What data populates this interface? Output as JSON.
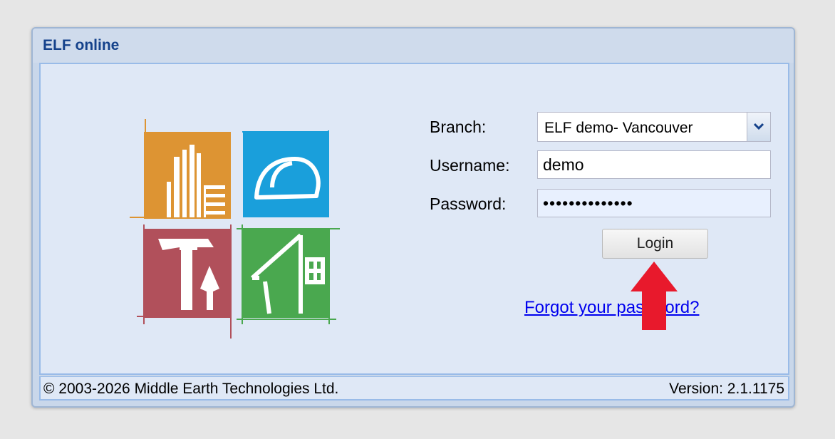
{
  "window": {
    "title": "ELF online"
  },
  "form": {
    "branch_label": "Branch:",
    "branch_value": "ELF demo- Vancouver",
    "username_label": "Username:",
    "username_value": "demo",
    "password_label": "Password:",
    "password_value": "••••••••••••••",
    "login_label": "Login",
    "forgot_link": "Forgot your password?"
  },
  "footer": {
    "copyright": "© 2003-2026 Middle Earth Technologies Ltd.",
    "version": "Version:  2.1.1175"
  },
  "icons": {
    "branch_dropdown": "chevron-down-icon",
    "annotation": "red-up-arrow-icon",
    "logo": "elf-logo"
  },
  "colors": {
    "title": "#15428b",
    "panel_bg": "#dfe8f6",
    "logo_orange": "#dd9433",
    "logo_blue": "#1a9fdb",
    "logo_red": "#b1505b",
    "logo_green": "#4aa84f",
    "arrow_red": "#e8192c",
    "link": "#0000ee"
  }
}
